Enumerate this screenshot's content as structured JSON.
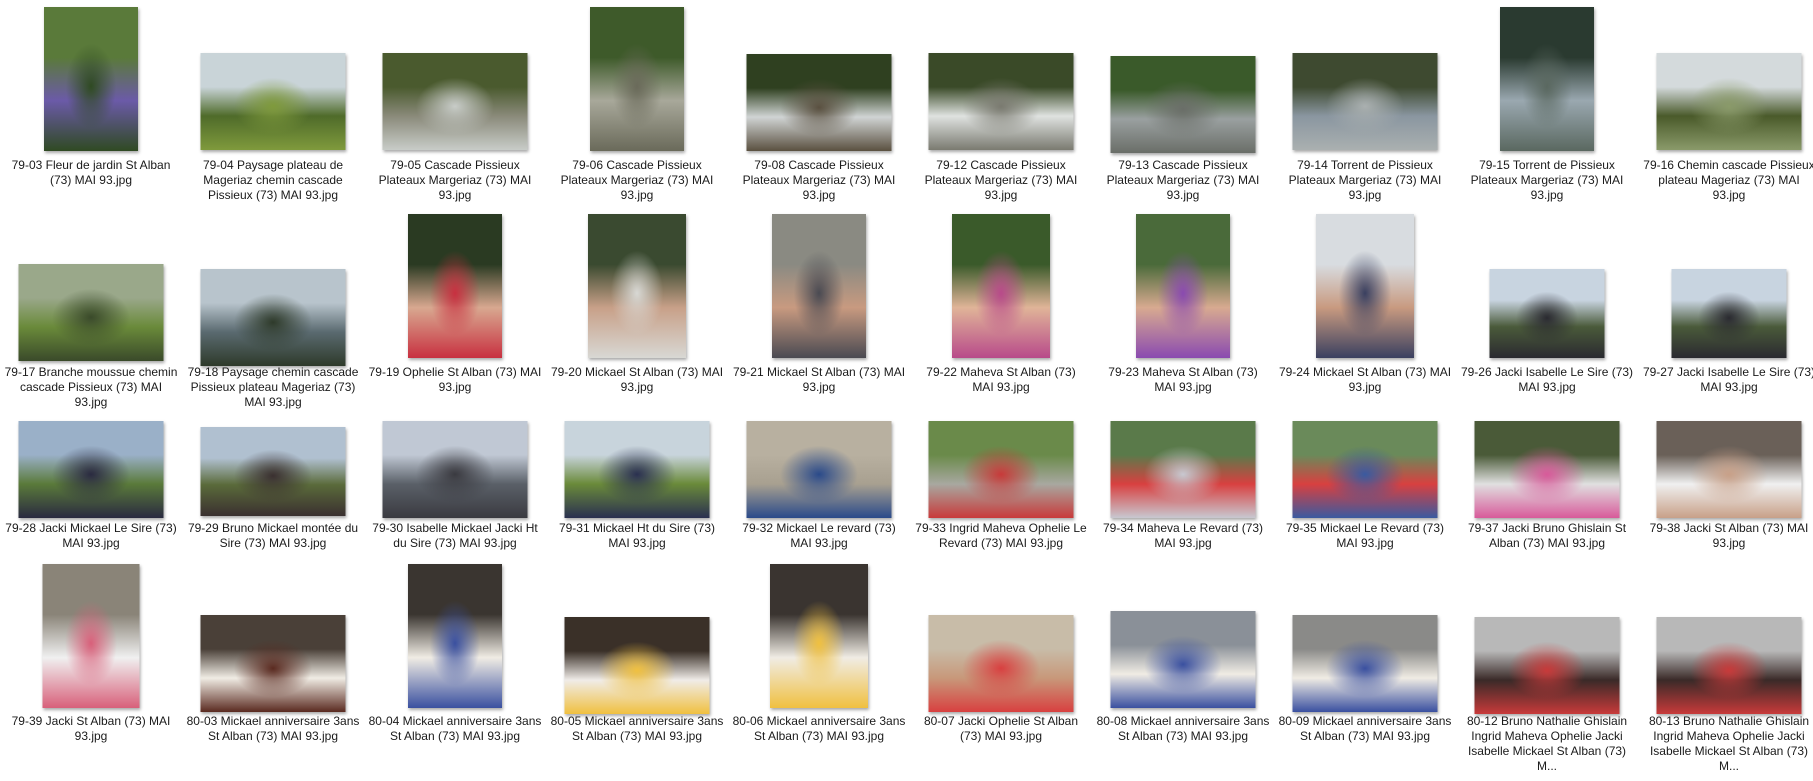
{
  "items": [
    {
      "caption": "79-03 Fleur de jardin St Alban (73) MAI 93.jpg",
      "colors": [
        "#5a7a3a",
        "#6b5aa8",
        "#2f4a22"
      ]
    },
    {
      "caption": "79-04 Paysage plateau de Mageriaz chemin cascade Pissieux (73) MAI 93.jpg",
      "colors": [
        "#c9d4d8",
        "#4f6b2a",
        "#7f9a3c"
      ]
    },
    {
      "caption": "79-05 Cascade Pissieux Plateaux Margeriaz (73) MAI 93.jpg",
      "colors": [
        "#4a5a2e",
        "#8a8a7a",
        "#c8ccc8"
      ]
    },
    {
      "caption": "79-06 Cascade Pissieux Plateaux Margeriaz (73) MAI 93.jpg",
      "colors": [
        "#3e5a2a",
        "#a8a89a",
        "#6a6a5a"
      ]
    },
    {
      "caption": "79-08 Cascade Pissieux Plateaux Margeriaz (73) MAI 93.jpg",
      "colors": [
        "#2f4020",
        "#d0d4d4",
        "#5a5040"
      ]
    },
    {
      "caption": "79-12 Cascade Pissieux Plateaux Margeriaz (73) MAI 93.jpg",
      "colors": [
        "#3a4a28",
        "#dfe2e0",
        "#7a7a70"
      ]
    },
    {
      "caption": "79-13 Cascade Pissieux Plateaux Margeriaz (73) MAI 93.jpg",
      "colors": [
        "#3a5a2a",
        "#9aa0a0",
        "#6a6e68"
      ]
    },
    {
      "caption": "79-14 Torrent de Pissieux Plateaux Margeriaz (73) MAI 93.jpg",
      "colors": [
        "#3e4a30",
        "#8a96a0",
        "#aab0b0"
      ]
    },
    {
      "caption": "79-15 Torrent de Pissieux Plateaux Margeriaz (73) MAI 93.jpg",
      "colors": [
        "#2a3a30",
        "#9aa8b0",
        "#5a6860"
      ]
    },
    {
      "caption": "79-16 Chemin cascade Pissieux plateau Mageriaz (73) MAI 93.jpg",
      "colors": [
        "#d4dadc",
        "#4a5a2a",
        "#8a9a6a"
      ]
    },
    {
      "caption": "79-17 Branche moussue chemin cascade Pissieux (73) MAI 93.jpg",
      "colors": [
        "#9aa88a",
        "#6a8a3a",
        "#3a4a2a"
      ]
    },
    {
      "caption": "79-18 Paysage chemin cascade Pissieux plateau Mageriaz (73) MAI 93.jpg",
      "colors": [
        "#b8c4cc",
        "#5a6a70",
        "#2e3a2a"
      ]
    },
    {
      "caption": "79-19 Ophelie St Alban (73) MAI 93.jpg",
      "colors": [
        "#2a3a22",
        "#d8a890",
        "#c83040"
      ]
    },
    {
      "caption": "79-20 Mickael St Alban (73) MAI 93.jpg",
      "colors": [
        "#3a4a30",
        "#c8a088",
        "#d8d8d4"
      ]
    },
    {
      "caption": "79-21 Mickael St Alban (73) MAI 93.jpg",
      "colors": [
        "#8a8a82",
        "#c89a80",
        "#4a4a52"
      ]
    },
    {
      "caption": "79-22 Maheva St Alban (73) MAI 93.jpg",
      "colors": [
        "#3a5a2a",
        "#e0b498",
        "#b84a8a"
      ]
    },
    {
      "caption": "79-23 Maheva St Alban (73) MAI 93.jpg",
      "colors": [
        "#4a6a3a",
        "#d8aa90",
        "#8a4ab0"
      ]
    },
    {
      "caption": "79-24 Mickael St Alban (73) MAI 93.jpg",
      "colors": [
        "#d8dce0",
        "#c89a80",
        "#3a4060"
      ]
    },
    {
      "caption": "79-26 Jacki Isabelle Le Sire (73) MAI 93.jpg",
      "colors": [
        "#c8d4e0",
        "#4a5a3a",
        "#2a2a30"
      ]
    },
    {
      "caption": "79-27 Jacki Isabelle Le Sire (73) MAI 93.jpg",
      "colors": [
        "#c8d4e0",
        "#4a5a3a",
        "#2a2a30"
      ]
    },
    {
      "caption": "79-28 Jacki Mickael Le Sire (73) MAI 93.jpg",
      "colors": [
        "#9ab0c8",
        "#5a7a3a",
        "#2a2a40"
      ]
    },
    {
      "caption": "79-29 Bruno Mickael montée du Sire (73) MAI 93.jpg",
      "colors": [
        "#b0c0d0",
        "#5a6a3a",
        "#3a3030"
      ]
    },
    {
      "caption": "79-30 Isabelle Mickael Jacki Ht du Sire (73) MAI 93.jpg",
      "colors": [
        "#c0c8d4",
        "#5a6068",
        "#3a3a40"
      ]
    },
    {
      "caption": "79-31 Mickael Ht du Sire (73) MAI 93.jpg",
      "colors": [
        "#c8d4dc",
        "#6a8a3a",
        "#2a3050"
      ]
    },
    {
      "caption": "79-32 Mickael Le revard (73) MAI 93.jpg",
      "colors": [
        "#b8b0a0",
        "#a8a090",
        "#2a4a8a"
      ]
    },
    {
      "caption": "79-33 Ingrid Maheva Ophelie Le Revard (73) MAI 93.jpg",
      "colors": [
        "#6a8a4a",
        "#a8a8a0",
        "#c83a3a"
      ]
    },
    {
      "caption": "79-34 Maheva Le Revard (73) MAI 93.jpg",
      "colors": [
        "#5a7a4a",
        "#d84040",
        "#c8c8d0"
      ]
    },
    {
      "caption": "79-35 Mickael Le Revard (73) MAI 93.jpg",
      "colors": [
        "#6a8a5a",
        "#d84040",
        "#3a5aa0"
      ]
    },
    {
      "caption": "79-37 Jacki Bruno Ghislain St Alban (73) MAI 93.jpg",
      "colors": [
        "#4a5a38",
        "#e0e0e0",
        "#d85a9a"
      ]
    },
    {
      "caption": "79-38 Jacki St Alban (73) MAI 93.jpg",
      "colors": [
        "#6a6058",
        "#f0f0f0",
        "#c8a088"
      ]
    },
    {
      "caption": "79-39 Jacki St Alban (73) MAI 93.jpg",
      "colors": [
        "#8a8478",
        "#f0f0f0",
        "#d8607a"
      ]
    },
    {
      "caption": "80-03 Mickael anniversaire 3ans St Alban (73) MAI 93.jpg",
      "colors": [
        "#4a4038",
        "#f0ece4",
        "#5a2a20"
      ]
    },
    {
      "caption": "80-04 Mickael anniversaire 3ans St Alban (73) MAI 93.jpg",
      "colors": [
        "#3a3530",
        "#f0ece4",
        "#3a50a0"
      ]
    },
    {
      "caption": "80-05 Mickael anniversaire 3ans St Alban (73) MAI 93.jpg",
      "colors": [
        "#3a3028",
        "#f0ece8",
        "#f0c040"
      ]
    },
    {
      "caption": "80-06 Mickael anniversaire 3ans St Alban (73) MAI 93.jpg",
      "colors": [
        "#3a3430",
        "#f0ece4",
        "#f0c040"
      ]
    },
    {
      "caption": "80-07 Jacki Ophelie St Alban (73) MAI 93.jpg",
      "colors": [
        "#c8bca8",
        "#c8987a",
        "#d84040"
      ]
    },
    {
      "caption": "80-08 Mickael anniversaire 3ans St Alban (73) MAI 93.jpg",
      "colors": [
        "#8a9098",
        "#f0ece4",
        "#3a50a0"
      ]
    },
    {
      "caption": "80-09 Mickael anniversaire 3ans St Alban (73) MAI 93.jpg",
      "colors": [
        "#8a8a88",
        "#f0ece4",
        "#3a50a0"
      ]
    },
    {
      "caption": "80-12 Bruno Nathalie Ghislain Ingrid Maheva Ophelie Jacki Isabelle Mickael St Alban (73) M...",
      "colors": [
        "#b8b8b8",
        "#3a2a28",
        "#c83a3a"
      ]
    },
    {
      "caption": "80-13 Bruno Nathalie Ghislain Ingrid Maheva Ophelie Jacki Isabelle Mickael St Alban (73) M...",
      "colors": [
        "#b8b8b8",
        "#3a2a28",
        "#c83a3a"
      ]
    }
  ]
}
